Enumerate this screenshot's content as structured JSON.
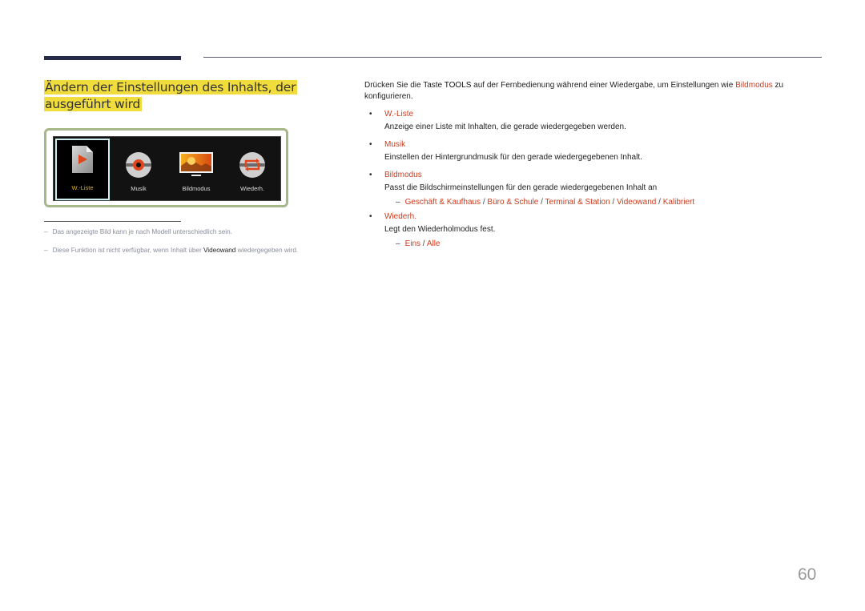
{
  "title": "Ändern der Einstellungen des Inhalts, der ausgeführt wird",
  "title_line1": "Ändern der Einstellungen des Inhalts, der",
  "title_line2": "ausgeführt wird",
  "screenshot": {
    "tiles": [
      {
        "label": "W.-Liste",
        "icon": "playlist-file-icon",
        "selected": true
      },
      {
        "label": "Musik",
        "icon": "music-disc-icon",
        "selected": false
      },
      {
        "label": "Bildmodus",
        "icon": "picture-mode-icon",
        "selected": false
      },
      {
        "label": "Wiederh.",
        "icon": "repeat-icon",
        "selected": false
      }
    ],
    "colors": {
      "selected_label": "#e0b020",
      "frame": "#a7b78a",
      "background": "#121212"
    }
  },
  "notes": [
    {
      "dash": "–",
      "text": "Das angezeigte Bild kann je nach Modell unterschiedlich sein."
    },
    {
      "dash": "–",
      "pre": "Diese Funktion ist nicht verfügbar, wenn Inhalt über ",
      "emph": "Videowand",
      "post": " wiedergegeben wird."
    }
  ],
  "intro": {
    "pre": "Drücken Sie die Taste ",
    "key": "TOOLS",
    "mid": " auf der Fernbedienung während einer Wiedergabe, um Einstellungen wie ",
    "link": "Bildmodus",
    "post": " zu konfigurieren."
  },
  "bullets": [
    {
      "head": "W.-Liste",
      "desc": "Anzeige einer Liste mit Inhalten, die gerade wiedergegeben werden."
    },
    {
      "head": "Musik",
      "desc": "Einstellen der Hintergrundmusik für den gerade wiedergegebenen Inhalt."
    },
    {
      "head": "Bildmodus",
      "desc": "Passt die Bildschirmeinstellungen für den gerade wiedergegebenen Inhalt an",
      "options": [
        "Geschäft & Kaufhaus",
        "Büro & Schule",
        "Terminal & Station",
        "Videowand",
        "Kalibriert"
      ]
    },
    {
      "head": "Wiederh.",
      "desc": "Legt den Wiederholmodus fest.",
      "options": [
        "Eins",
        "Alle"
      ]
    }
  ],
  "bullet_glyph": "•",
  "dash_glyph": "–",
  "separator": "/",
  "page_number": "60",
  "accent_color": "#cf3a1c",
  "highlight_color": "#f0dc3c"
}
